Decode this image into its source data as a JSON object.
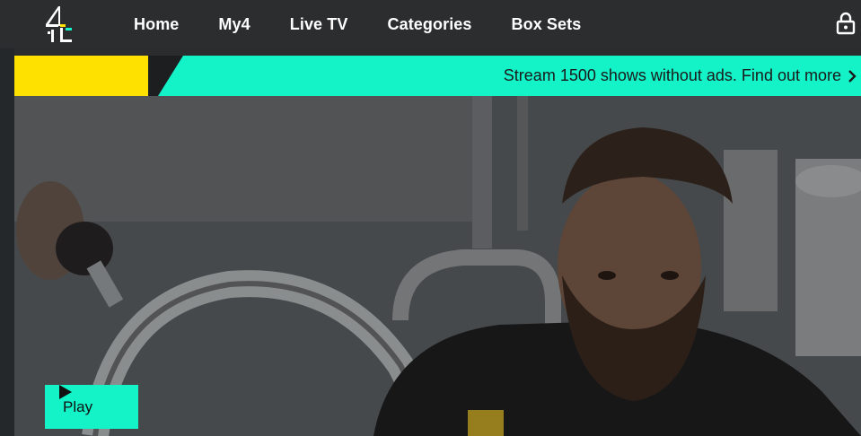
{
  "nav": {
    "items": [
      {
        "label": "Home"
      },
      {
        "label": "My4"
      },
      {
        "label": "Live TV"
      },
      {
        "label": "Categories"
      },
      {
        "label": "Box Sets"
      }
    ],
    "logo_icon": "channel4-logo-icon",
    "account_icon": "lock-icon"
  },
  "promo": {
    "text": "Stream 1500 shows without ads. Find out more",
    "chevron_icon": "chevron-right-icon"
  },
  "hero": {
    "play_label": "Play",
    "play_icon": "play-icon"
  },
  "colors": {
    "nav_bg": "#2b2d2f",
    "accent_teal": "#14f2c8",
    "accent_yellow": "#ffe100"
  }
}
